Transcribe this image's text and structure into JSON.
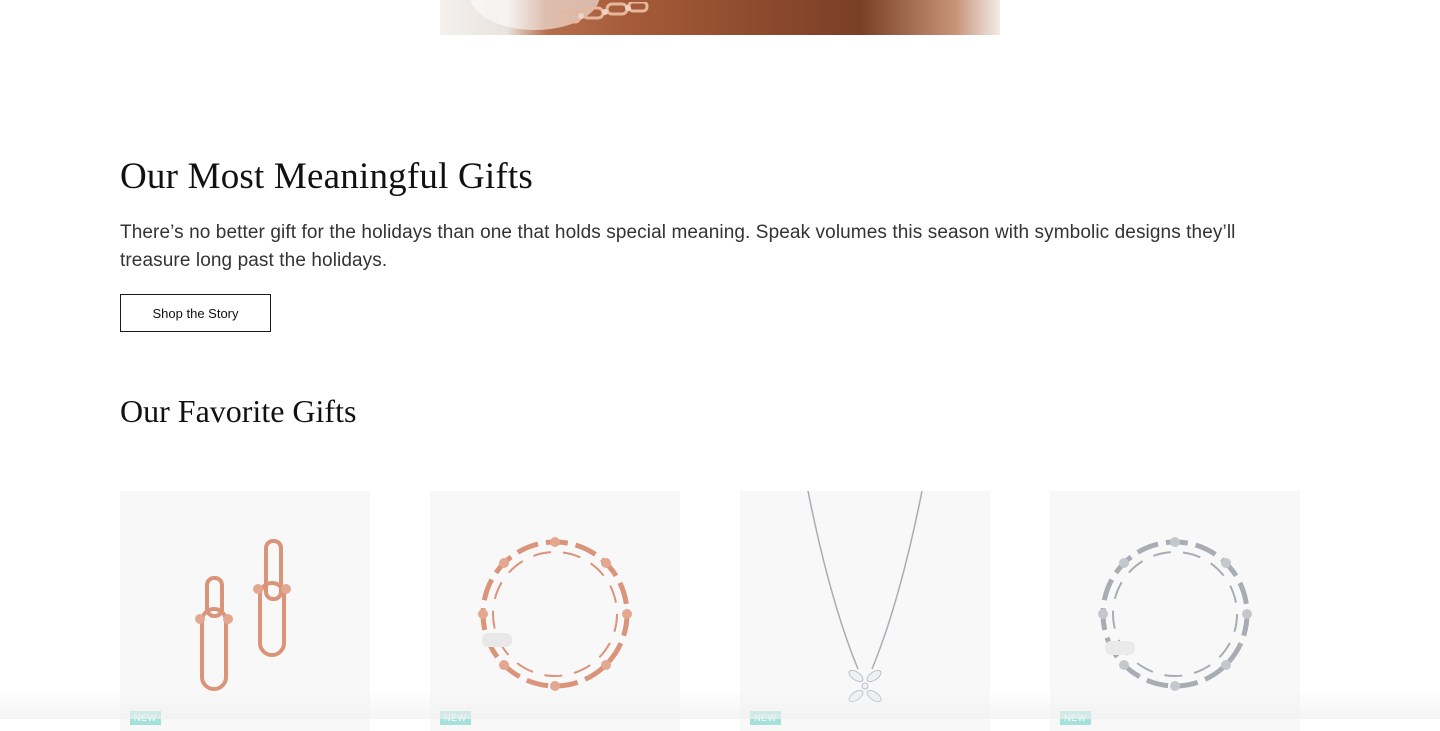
{
  "meaningful": {
    "title": "Our Most Meaningful Gifts",
    "body": "There’s no better gift for the holidays than one that holds special meaning. Speak volumes this season with symbolic designs they’ll treasure long past the holidays.",
    "cta_label": "Shop the Story"
  },
  "favorites": {
    "title": "Our Favorite Gifts",
    "products": [
      {
        "badge": "NEW",
        "icon": "rose-gold-link-earrings-icon"
      },
      {
        "badge": "NEW",
        "icon": "rose-gold-link-bracelet-icon"
      },
      {
        "badge": "NEW",
        "icon": "diamond-flower-necklace-icon"
      },
      {
        "badge": "NEW",
        "icon": "silver-link-bracelet-icon"
      }
    ]
  },
  "colors": {
    "rose_gold": "#d9947a",
    "silver": "#a9adb3",
    "badge": "#81d8d0"
  }
}
